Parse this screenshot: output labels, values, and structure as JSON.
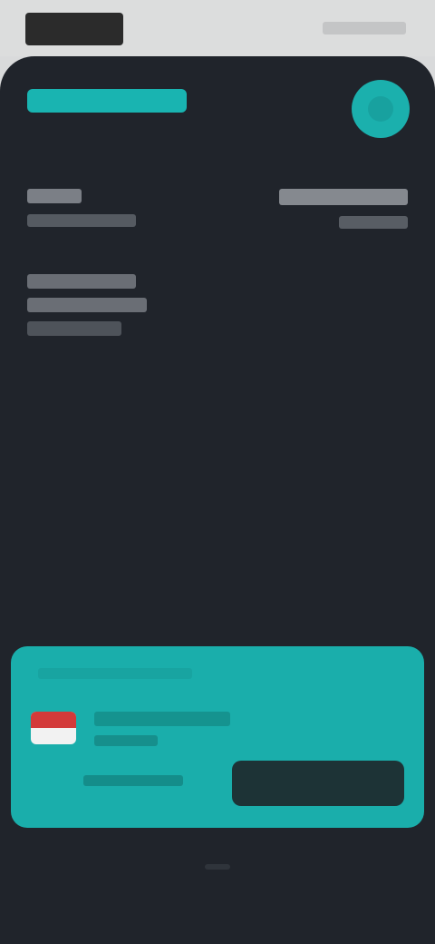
{
  "status_bar": {
    "time": "",
    "indicators": ""
  },
  "header": {
    "brand": "",
    "title": "",
    "avatar_icon": "user-icon"
  },
  "info": {
    "label": "",
    "value": "",
    "right_primary": "",
    "right_secondary": ""
  },
  "description": {
    "lines": [
      "",
      "",
      ""
    ]
  },
  "promo": {
    "stripe_text": "",
    "flag_icon": "flag-icon",
    "title": "",
    "subtitle": "",
    "footnote": "",
    "button_label": ""
  },
  "colors": {
    "accent": "#1aaeab",
    "background": "#20242b",
    "button_dark": "#1d3336"
  }
}
